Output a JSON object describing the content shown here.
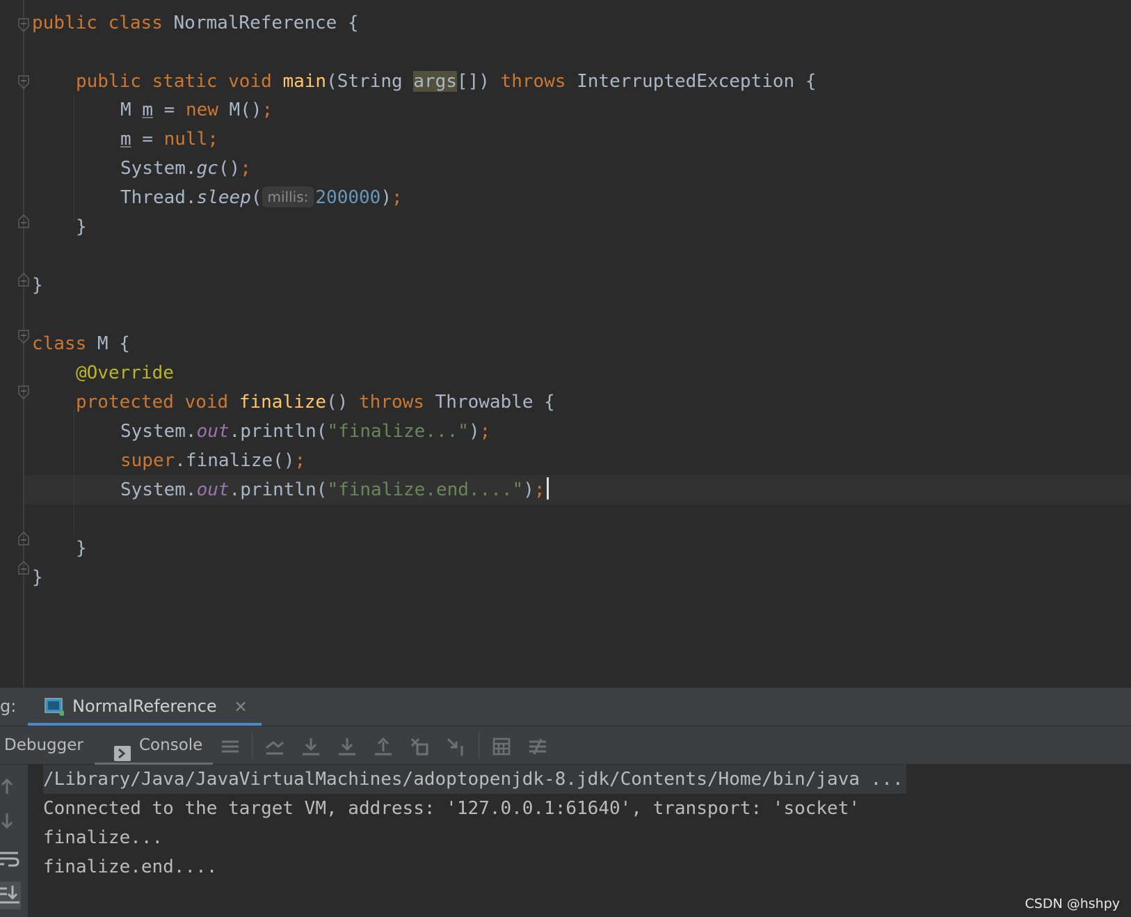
{
  "editor": {
    "code": {
      "l1": [
        "public",
        "class",
        "NormalReference {"
      ],
      "l3": [
        "public",
        "static",
        "void",
        "main",
        "(String ",
        "args",
        "[]) ",
        "throws",
        " InterruptedException {"
      ],
      "l4": [
        "M ",
        "m",
        " = ",
        "new",
        " M()",
        ";"
      ],
      "l5": [
        "m",
        " = ",
        "null",
        ";"
      ],
      "l6": [
        "System.",
        "gc",
        "()",
        ";"
      ],
      "l7": [
        "Thread.",
        "sleep",
        "(",
        "millis:",
        "200000",
        ")",
        ";"
      ],
      "l8": "}",
      "l10": "}",
      "l12": [
        "class",
        " M {"
      ],
      "l13": "@Override",
      "l14": [
        "protected",
        "void",
        "finalize",
        "() ",
        "throws",
        " Throwable {"
      ],
      "l15": [
        "System.",
        "out",
        ".println(",
        "\"finalize...\"",
        ")",
        ";"
      ],
      "l16": [
        "super",
        ".finalize()",
        ";"
      ],
      "l17": [
        "System.",
        "out",
        ".println(",
        "\"finalize.end....\"",
        ")",
        ";"
      ],
      "l19": "}",
      "l20": "}"
    }
  },
  "debug_window": {
    "title": "g:",
    "run_tab": {
      "label": "NormalReference",
      "close": "×"
    },
    "tabs": {
      "debugger": "Debugger",
      "console": "Console"
    }
  },
  "console": {
    "lines": [
      "/Library/Java/JavaVirtualMachines/adoptopenjdk-8.jdk/Contents/Home/bin/java ...",
      "Connected to the target VM, address: '127.0.0.1:61640', transport: 'socket'",
      "finalize...",
      "finalize.end...."
    ]
  },
  "watermark": "CSDN @hshpy",
  "colors": {
    "editor_bg": "#2b2b2b",
    "keyword": "#cc7832",
    "function": "#ffc66d",
    "string": "#6a8759",
    "number": "#6897bb",
    "annotation": "#bbb529",
    "field": "#9876aa",
    "tab_accent": "#4a88c7"
  }
}
